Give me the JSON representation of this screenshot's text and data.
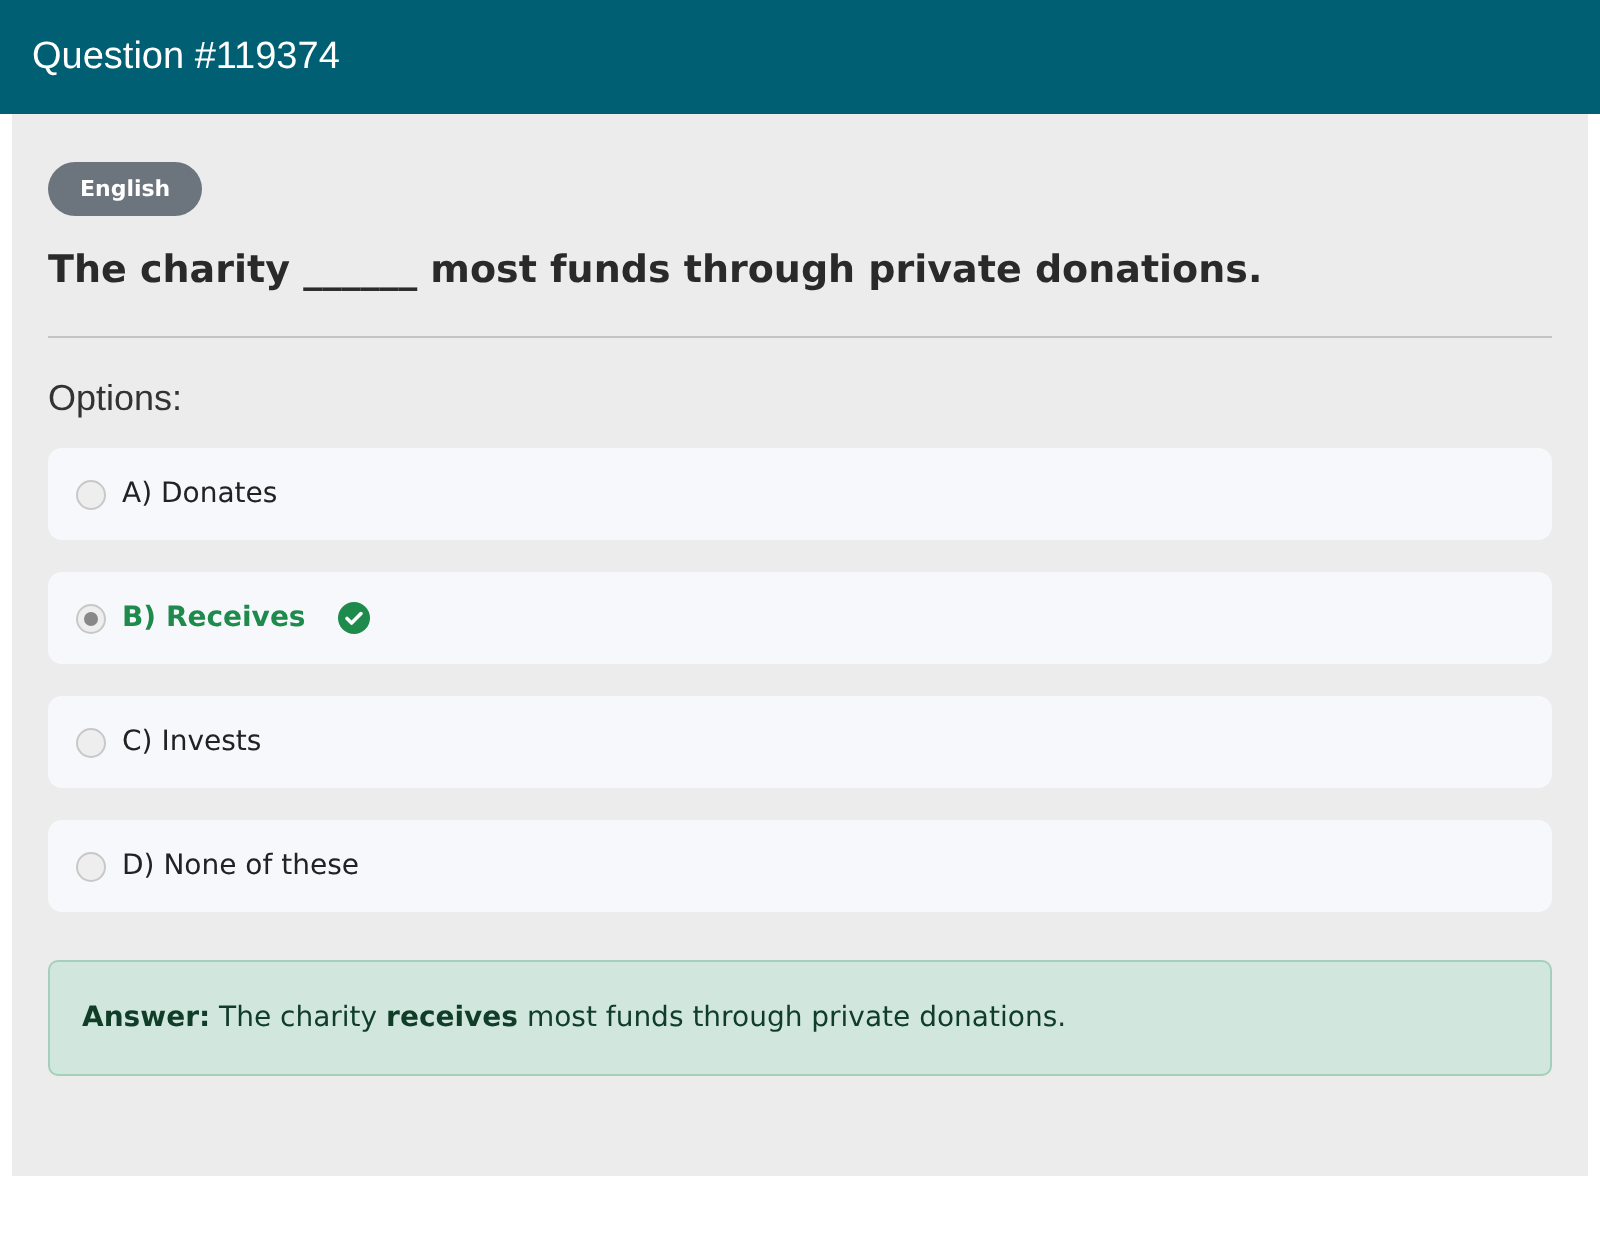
{
  "header": {
    "title": "Question #119374"
  },
  "language_badge": "English",
  "question": "The charity ______ most funds through private donations.",
  "options_heading": "Options:",
  "options": [
    {
      "label": "A) Donates",
      "selected": false,
      "correct": false
    },
    {
      "label": "B) Receives",
      "selected": true,
      "correct": true
    },
    {
      "label": "C) Invests",
      "selected": false,
      "correct": false
    },
    {
      "label": "D) None of these",
      "selected": false,
      "correct": false
    }
  ],
  "answer": "**Answer:** The charity **receives** most funds through private donations."
}
